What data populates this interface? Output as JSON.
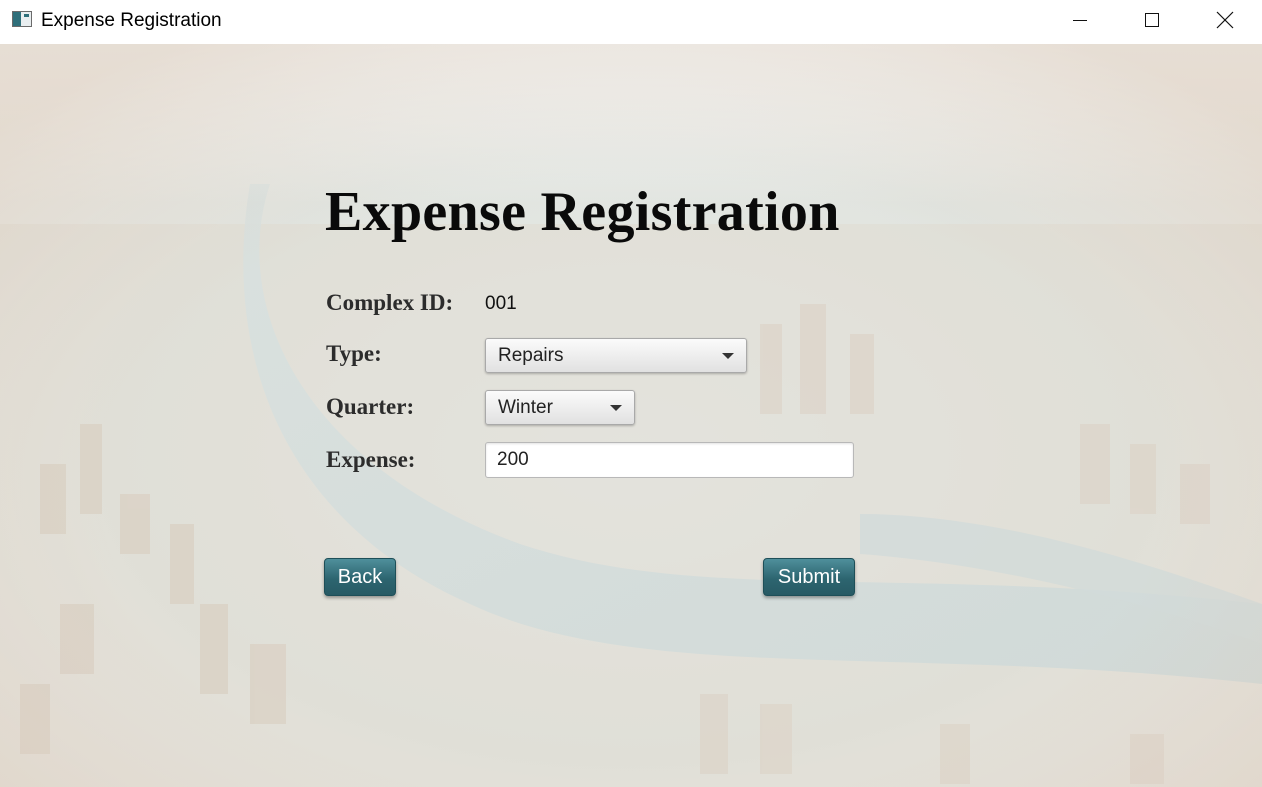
{
  "window": {
    "title": "Expense Registration",
    "controls": [
      "minimize-icon",
      "maximize-icon",
      "close-icon"
    ]
  },
  "page": {
    "heading": "Expense Registration"
  },
  "form": {
    "complex_id": {
      "label": "Complex ID:",
      "value": "001"
    },
    "type": {
      "label": "Type:",
      "selected": "Repairs"
    },
    "quarter": {
      "label": "Quarter:",
      "selected": "Winter"
    },
    "expense": {
      "label": "Expense:",
      "value": "200"
    }
  },
  "actions": {
    "back_label": "Back",
    "submit_label": "Submit"
  },
  "colors": {
    "button_accent": "#2d6570",
    "background_tint": "#e8ecea"
  }
}
